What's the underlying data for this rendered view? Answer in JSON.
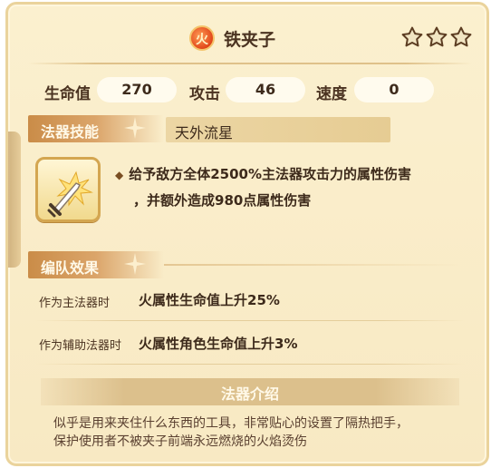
{
  "item": {
    "title": "铁夹子",
    "element_glyph": "火",
    "element_color": "#e2471a",
    "stars": 3
  },
  "stats": {
    "hp_label": "生命值",
    "hp_value": "270",
    "atk_label": "攻击",
    "atk_value": "46",
    "spd_label": "速度",
    "spd_value": "0"
  },
  "skill": {
    "section_label": "法器技能",
    "name": "天外流星",
    "icon": "sword-burst-icon",
    "desc_line1": "给予敌方全体2500%主法器攻击力的属性伤害",
    "desc_line2": "，并额外造成980点属性伤害"
  },
  "formation": {
    "section_label": "编队效果",
    "main_label": "作为主法器时",
    "main_value": "火属性生命值上升25%",
    "sub_label": "作为辅助法器时",
    "sub_value": "火属性角色生命值上升3%"
  },
  "intro": {
    "title": "法器介绍",
    "line1": "似乎是用来夹住什么东西的工具，非常贴心的设置了隔热把手，",
    "line2": "保护使用者不被夹子前端永远燃烧的火焰烫伤"
  }
}
